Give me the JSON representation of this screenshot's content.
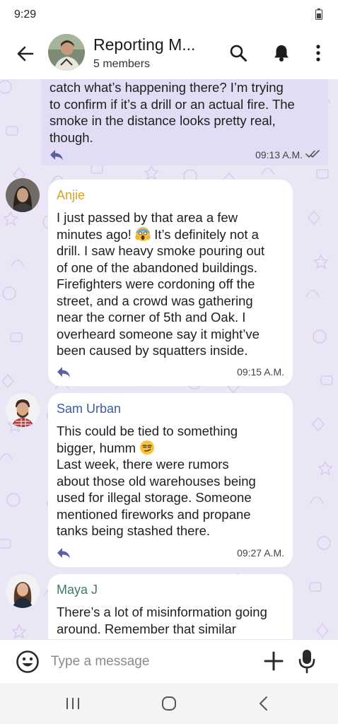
{
  "status_bar": {
    "time": "9:29"
  },
  "header": {
    "title": "Reporting M...",
    "subtitle": "5 members"
  },
  "messages": [
    {
      "direction": "outgoing",
      "lines": [
        "catch what’s happening there? I’m trying",
        "to confirm if it’s a drill or an actual fire. The",
        "smoke in the distance looks pretty real,",
        "though."
      ],
      "time": "09:13 A.M."
    },
    {
      "direction": "incoming",
      "sender": "Anjie",
      "sender_color": "#d9a421",
      "lines": [
        "I just passed by that area a few",
        "minutes ago!",
        "It’s definitely not a",
        "drill. I saw heavy smoke pouring out",
        "of one of the abandoned buildings.",
        "Firefighters were cordoning off the",
        "street, and a crowd was gathering",
        "near the corner of 5th and Oak. I",
        "overheard someone say it might’ve",
        "been caused by squatters inside."
      ],
      "time": "09:15 A.M."
    },
    {
      "direction": "incoming",
      "sender": "Sam Urban",
      "sender_color": "#3c5aa8",
      "lines": [
        "This could be tied to something",
        "bigger, humm",
        "Last week, there were rumors",
        "about those old warehouses being",
        "used for illegal storage. Someone",
        "mentioned fireworks and propane",
        "tanks being stashed there."
      ],
      "time": "09:27 A.M."
    },
    {
      "direction": "incoming",
      "sender": "Maya J",
      "sender_color": "#3f7a6a",
      "lines": [
        "There’s a lot of misinformation going",
        "around. Remember that similar"
      ]
    }
  ],
  "composer": {
    "placeholder": "Type a message"
  },
  "colors": {
    "chat_background": "#ebe6f6",
    "outgoing_bubble": "#e2dcf4",
    "reply_icon": "#5c5fa8",
    "read_ticks": "#555555"
  }
}
